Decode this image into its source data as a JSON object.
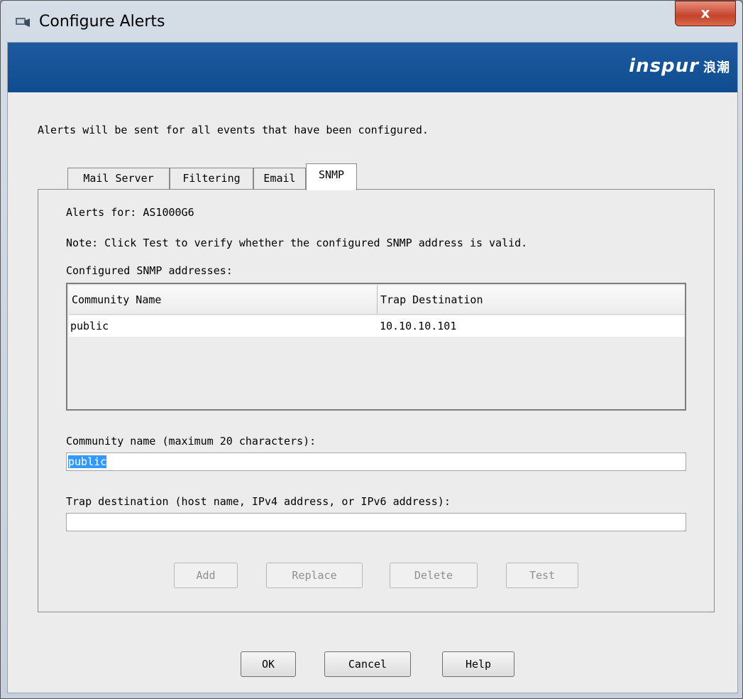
{
  "window": {
    "title": "Configure Alerts",
    "close_glyph": "x"
  },
  "banner": {
    "logo_text": "inspur",
    "logo_cn": "浪潮"
  },
  "intro_text": "Alerts will be sent for all events that have been configured.",
  "tabs": [
    {
      "label": "Mail Server",
      "active": false
    },
    {
      "label": "Filtering",
      "active": false
    },
    {
      "label": "Email",
      "active": false
    },
    {
      "label": "SNMP",
      "active": true
    }
  ],
  "snmp": {
    "alerts_for": "Alerts for: AS1000G6",
    "note": "Note: Click Test to verify whether the configured SNMP address is valid.",
    "configured_label": "Configured SNMP addresses:",
    "table": {
      "columns": [
        "Community Name",
        "Trap Destination"
      ],
      "rows": [
        {
          "community": "public",
          "destination": "10.10.10.101"
        }
      ]
    },
    "community_label": "Community name (maximum 20 characters):",
    "community_value": "public",
    "trap_label": "Trap destination (host name, IPv4 address, or IPv6 address):",
    "trap_value": "",
    "buttons": {
      "add": "Add",
      "replace": "Replace",
      "delete": "Delete",
      "test": "Test"
    }
  },
  "footer": {
    "ok": "OK",
    "cancel": "Cancel",
    "help": "Help"
  }
}
